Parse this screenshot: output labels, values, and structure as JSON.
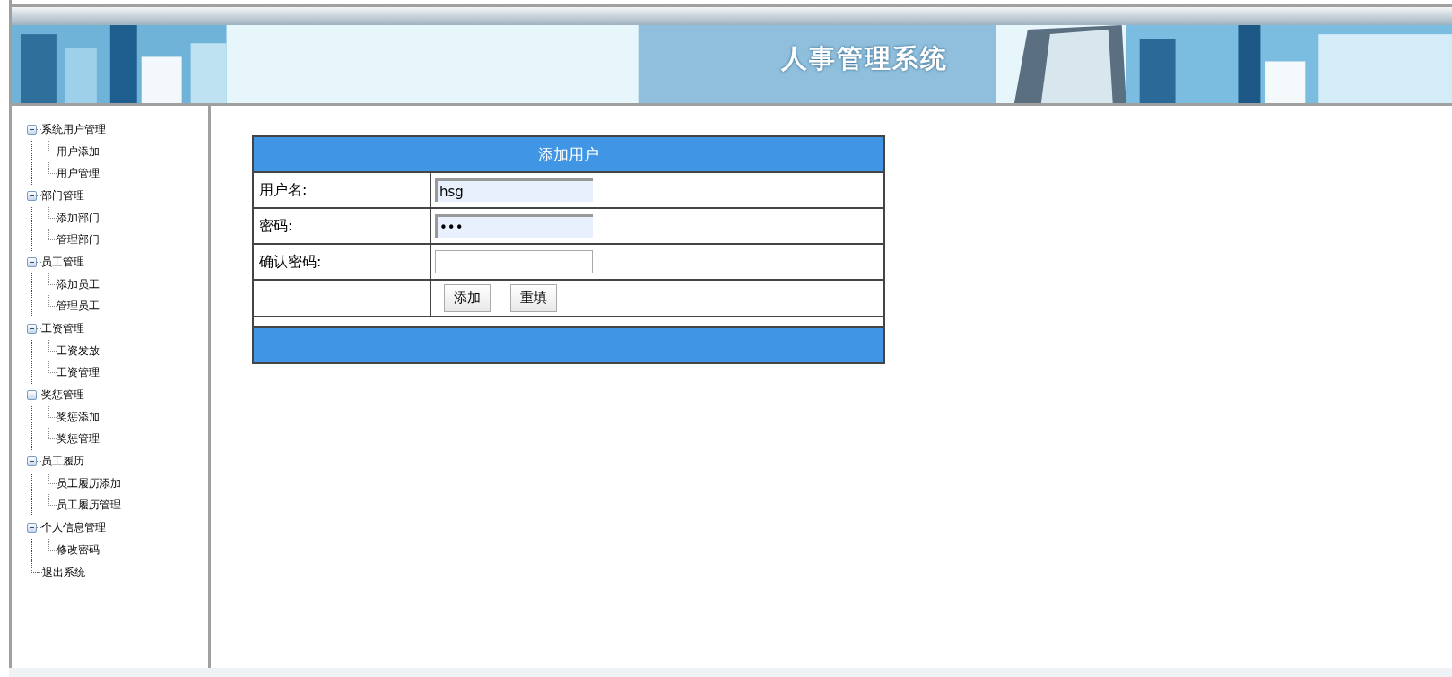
{
  "header": {
    "title": "人事管理系统"
  },
  "sidebar": {
    "items": [
      {
        "label": "系统用户管理",
        "expanded": true,
        "children": [
          {
            "label": "用户添加"
          },
          {
            "label": "用户管理"
          }
        ]
      },
      {
        "label": "部门管理",
        "expanded": true,
        "children": [
          {
            "label": "添加部门"
          },
          {
            "label": "管理部门"
          }
        ]
      },
      {
        "label": "员工管理",
        "expanded": true,
        "children": [
          {
            "label": "添加员工"
          },
          {
            "label": "管理员工"
          }
        ]
      },
      {
        "label": "工资管理",
        "expanded": true,
        "children": [
          {
            "label": "工资发放"
          },
          {
            "label": "工资管理"
          }
        ]
      },
      {
        "label": "奖惩管理",
        "expanded": true,
        "children": [
          {
            "label": "奖惩添加"
          },
          {
            "label": "奖惩管理"
          }
        ]
      },
      {
        "label": "员工履历",
        "expanded": true,
        "children": [
          {
            "label": "员工履历添加"
          },
          {
            "label": "员工履历管理"
          }
        ]
      },
      {
        "label": "个人信息管理",
        "expanded": true,
        "children": [
          {
            "label": "修改密码"
          }
        ]
      },
      {
        "label": "退出系统"
      }
    ]
  },
  "form": {
    "title": "添加用户",
    "fields": [
      {
        "label": "用户名:",
        "value": "hsg",
        "autofilled": true
      },
      {
        "label": "密码:",
        "value": "•••",
        "autofilled": true
      },
      {
        "label": "确认密码:",
        "autofilled": false
      }
    ],
    "buttons": [
      "添加",
      "重填"
    ]
  }
}
